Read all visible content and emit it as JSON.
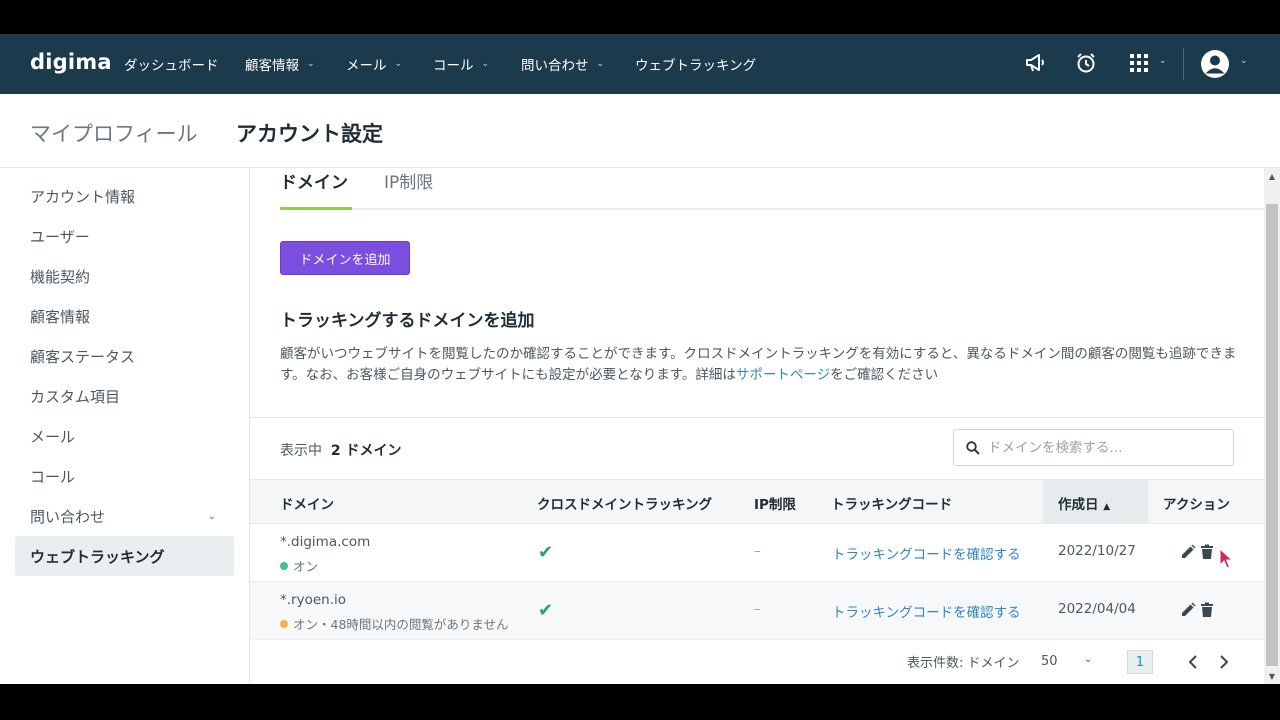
{
  "nav": {
    "logo_text": "digima",
    "items": [
      {
        "label": "ダッシュボード",
        "has_dropdown": false
      },
      {
        "label": "顧客情報",
        "has_dropdown": true
      },
      {
        "label": "メール",
        "has_dropdown": true
      },
      {
        "label": "コール",
        "has_dropdown": true
      },
      {
        "label": "問い合わせ",
        "has_dropdown": true
      },
      {
        "label": "ウェブトラッキング",
        "has_dropdown": false
      }
    ],
    "icons": [
      "megaphone-icon",
      "alarm-clock-icon",
      "apps-grid-icon",
      "user-avatar-icon"
    ]
  },
  "header": {
    "breadcrumb_link": "マイプロフィール",
    "title": "アカウント設定"
  },
  "sidebar": {
    "items": [
      {
        "label": "アカウント情報",
        "active": false
      },
      {
        "label": "ユーザー",
        "active": false
      },
      {
        "label": "機能契約",
        "active": false
      },
      {
        "label": "顧客情報",
        "active": false
      },
      {
        "label": "顧客ステータス",
        "active": false
      },
      {
        "label": "カスタム項目",
        "active": false
      },
      {
        "label": "メール",
        "active": false
      },
      {
        "label": "コール",
        "active": false
      },
      {
        "label": "問い合わせ",
        "active": false,
        "has_dropdown": true
      },
      {
        "label": "ウェブトラッキング",
        "active": true
      }
    ]
  },
  "tabs": [
    {
      "label": "ドメイン",
      "active": true
    },
    {
      "label": "IP制限",
      "active": false
    }
  ],
  "add_button_label": "ドメインを追加",
  "section": {
    "title": "トラッキングするドメインを追加",
    "desc_before_link": "顧客がいつウェブサイトを閲覧したのか確認することができます。クロスドメイントラッキングを有効にすると、異なるドメイン間の顧客の閲覧も追跡できます。なお、お客様ご自身のウェブサイトにも設定が必要となります。詳細は",
    "desc_link": "サポートページ",
    "desc_after_link": "をご確認ください"
  },
  "table": {
    "count_prefix": "表示中",
    "count_value": "2 ドメイン",
    "search_placeholder": "ドメインを検索する...",
    "columns": {
      "domain": "ドメイン",
      "cross": "クロスドメイントラッキング",
      "ip": "IP制限",
      "code": "トラッキングコード",
      "created": "作成日",
      "sort_indicator": "▲",
      "actions": "アクション"
    },
    "rows": [
      {
        "domain": "*.digima.com",
        "status": "オン",
        "status_color": "#3cc38a",
        "cross_tracking": "✔",
        "ip": "–",
        "code_link": "トラッキングコードを確認する",
        "created": "2022/10/27"
      },
      {
        "domain": "*.ryoen.io",
        "status": "オン・48時間以内の閲覧がありません",
        "status_color": "#f2b441",
        "cross_tracking": "✔",
        "ip": "–",
        "code_link": "トラッキングコードを確認する",
        "created": "2022/04/04"
      }
    ]
  },
  "pagination": {
    "label": "表示件数: ドメイン",
    "page_size": "50",
    "current_page": "1"
  },
  "colors": {
    "nav_bg": "#1b3a4b",
    "accent_green": "#8bd24a",
    "primary_button": "#7b4ee0",
    "link": "#2f86c2"
  }
}
